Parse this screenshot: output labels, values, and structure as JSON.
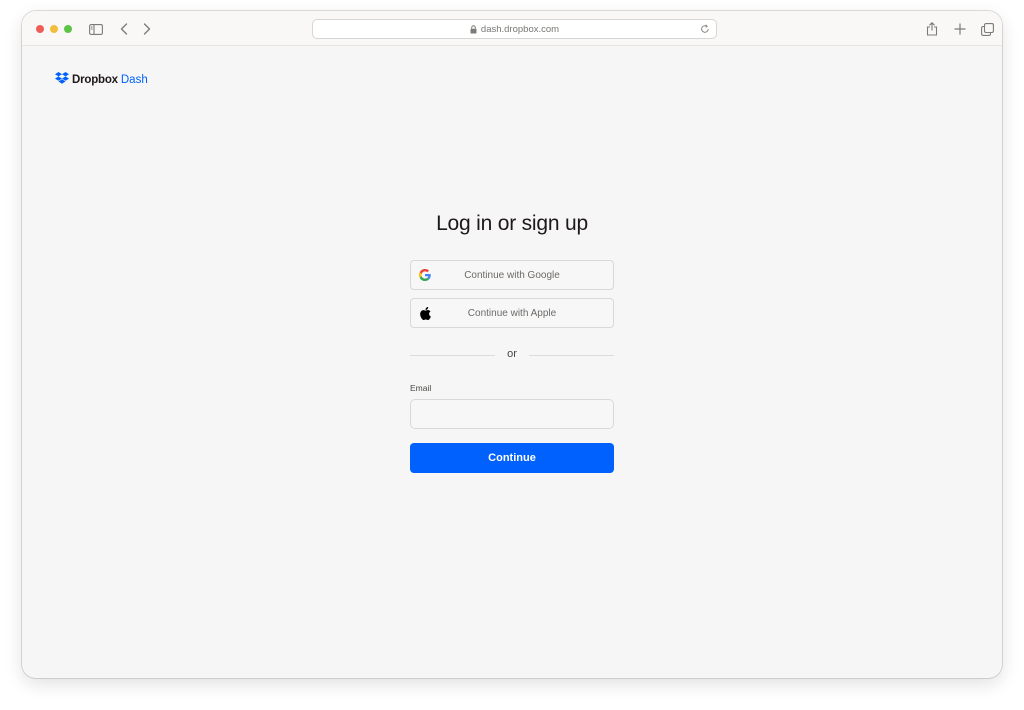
{
  "browser": {
    "url": "dash.dropbox.com"
  },
  "brand": {
    "name": "Dropbox",
    "product": "Dash",
    "accent": "#0061fe"
  },
  "login": {
    "title": "Log in or sign up",
    "google_label": "Continue with Google",
    "apple_label": "Continue with Apple",
    "divider_text": "or",
    "email_label": "Email",
    "email_value": "",
    "continue_label": "Continue"
  },
  "icons": {
    "titlebar": [
      "sidebar-icon",
      "back-icon",
      "forward-icon",
      "lock-icon",
      "reload-icon",
      "share-icon",
      "new-tab-icon",
      "tabs-overview-icon"
    ],
    "auth": [
      "google-icon",
      "apple-icon"
    ]
  }
}
